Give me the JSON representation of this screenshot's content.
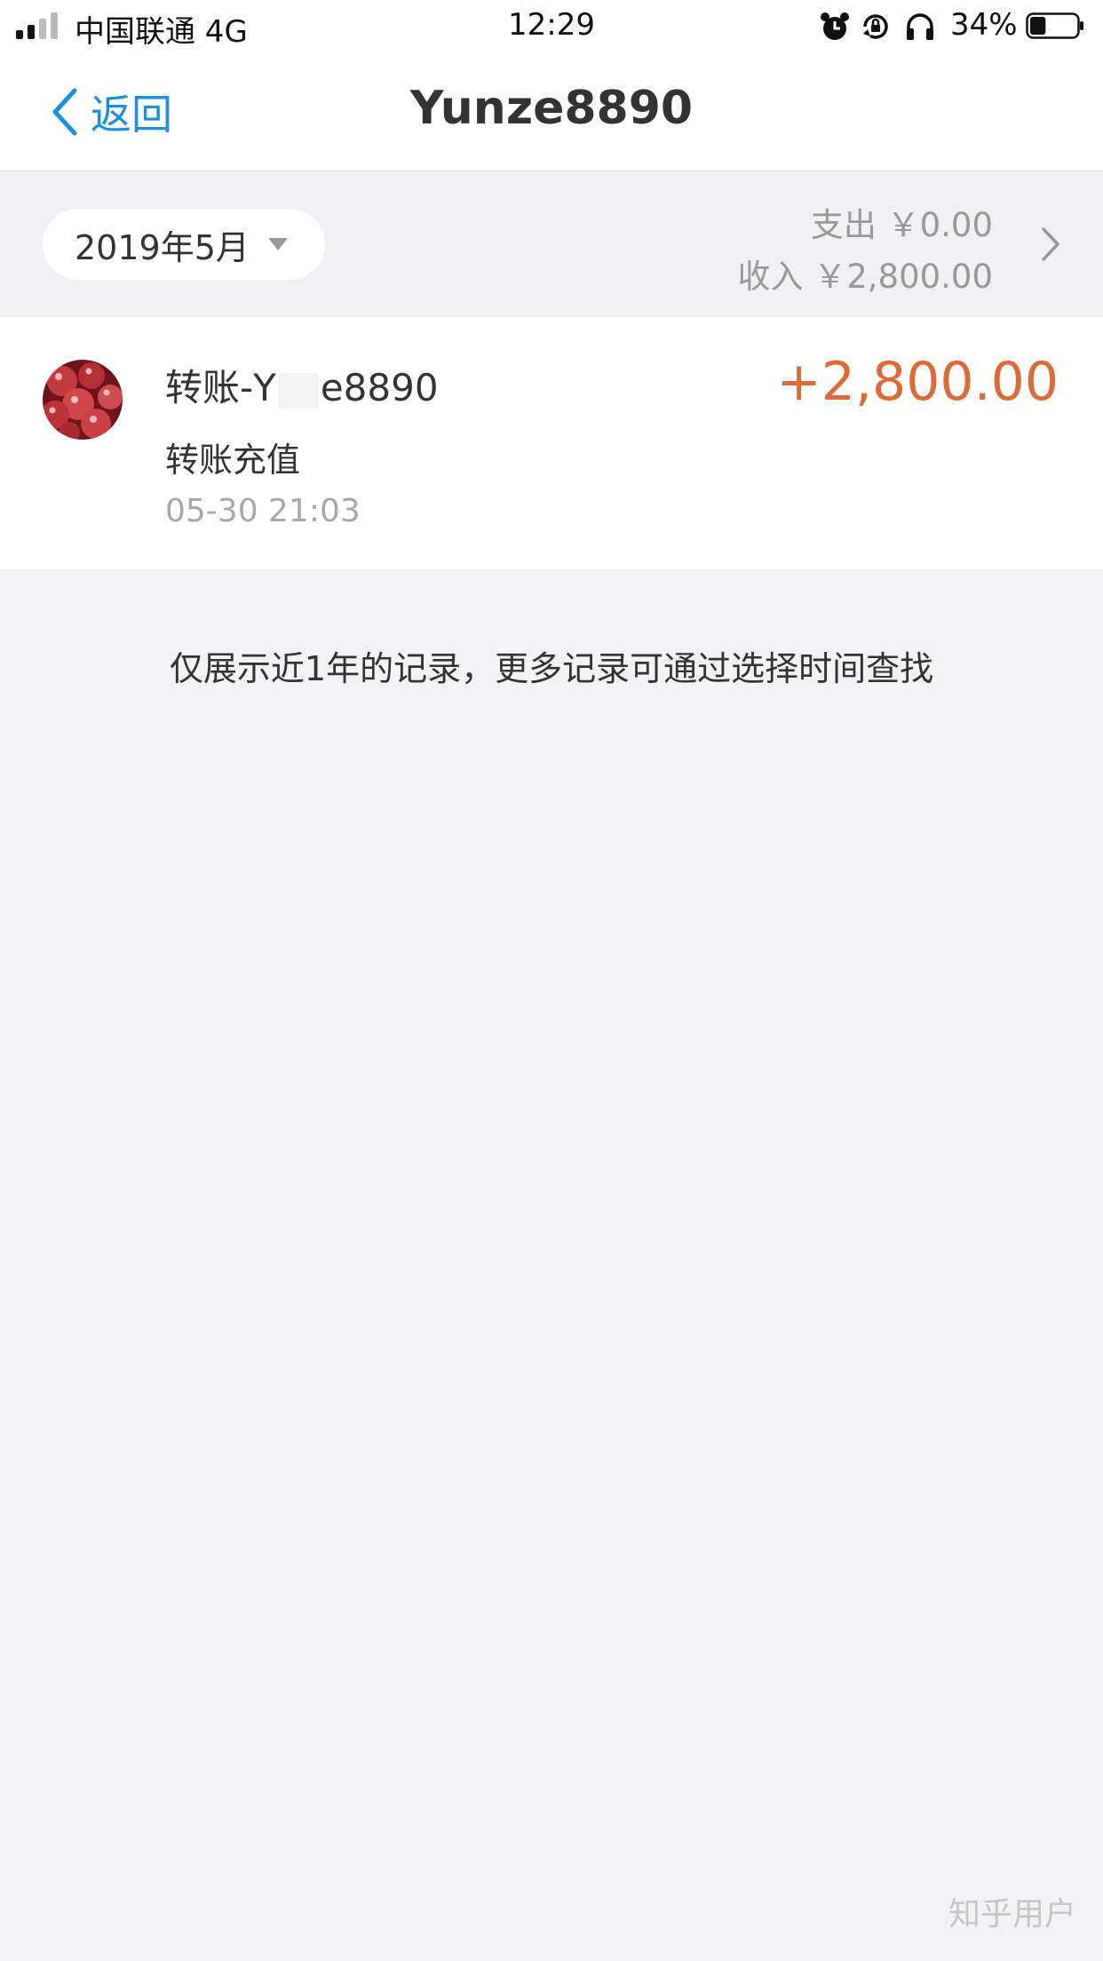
{
  "status_bar": {
    "carrier": "中国联通 4G",
    "time": "12:29",
    "battery_percent": "34%",
    "battery_level": 0.34,
    "icons": [
      "alarm-icon",
      "rotation-lock-icon",
      "headphones-icon",
      "battery-icon"
    ]
  },
  "nav": {
    "back_label": "返回",
    "title": "Yunze8890"
  },
  "summary": {
    "month": "2019年5月",
    "expense": "支出 ￥0.00",
    "income": "收入 ￥2,800.00"
  },
  "transactions": [
    {
      "name_prefix": "转账-Y",
      "name_suffix": "e8890",
      "type": "转账充值",
      "time": "05-30  21:03",
      "amount": "+2,800.00"
    }
  ],
  "note": "仅展示近1年的记录，更多记录可通过选择时间查找",
  "watermark": "知乎用户",
  "colors": {
    "accent_blue": "#1d8fe1",
    "amount_orange": "#e06a36",
    "background": "#f3f3f5"
  }
}
